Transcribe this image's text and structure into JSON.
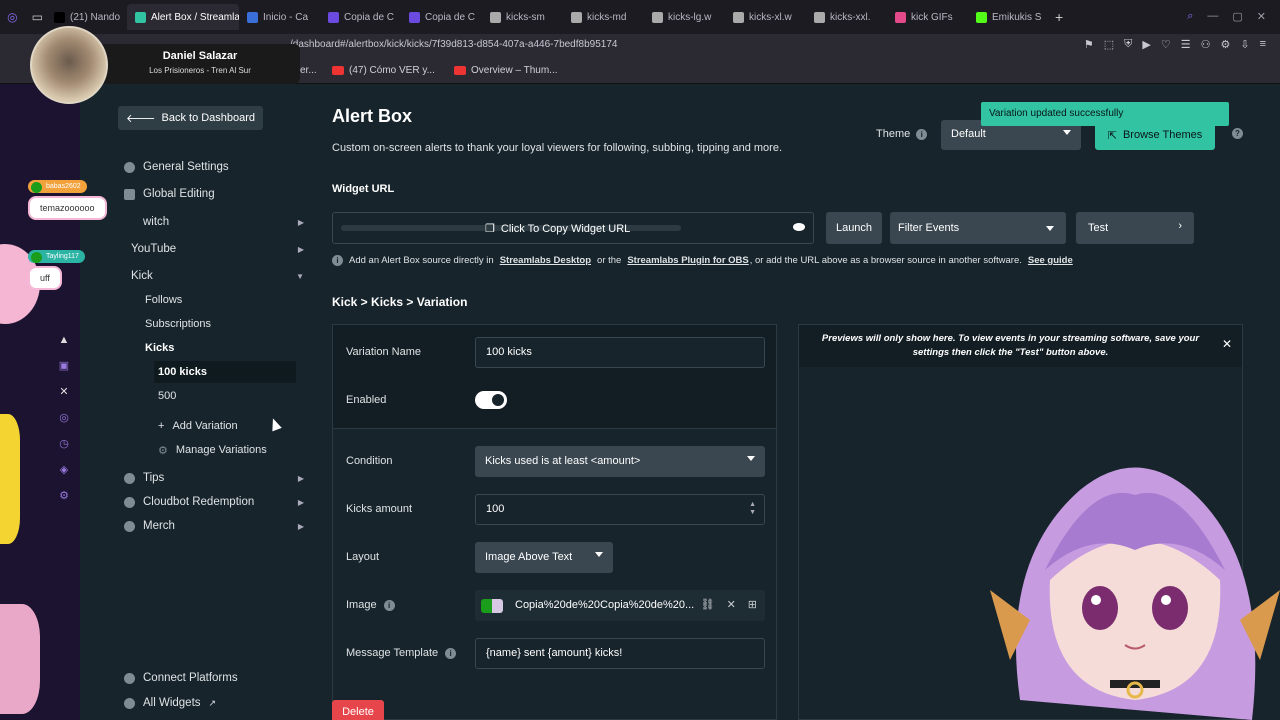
{
  "browser": {
    "tabs": [
      {
        "label": "(21) Nando",
        "color": "#000000"
      },
      {
        "label": "Alert Box / Streamlabs",
        "color": "#31c3a2",
        "active": true
      },
      {
        "label": "Inicio - Ca",
        "color": "#3b6fd8"
      },
      {
        "label": "Copia de C",
        "color": "#6b4ae0"
      },
      {
        "label": "Copia de C",
        "color": "#6b4ae0"
      },
      {
        "label": "kicks-sm",
        "color": "#aaaaaa"
      },
      {
        "label": "kicks-md",
        "color": "#aaaaaa"
      },
      {
        "label": "kicks-lg.w",
        "color": "#aaaaaa"
      },
      {
        "label": "kicks-xl.w",
        "color": "#aaaaaa"
      },
      {
        "label": "kicks-xxl.",
        "color": "#aaaaaa"
      },
      {
        "label": "kick GIFs",
        "color": "#e34a8a"
      },
      {
        "label": "Emikukis S",
        "color": "#53fc18"
      }
    ],
    "url": "/dashboard#/alertbox/kick/kicks/7f39d813-d854-407a-a446-7bedf8b95174",
    "bookmarks": [
      {
        "label": "er..."
      },
      {
        "label": "(47) Cómo VER y..."
      },
      {
        "label": "Overview – Thum..."
      }
    ]
  },
  "overlay": {
    "profile_name": "Daniel Salazar",
    "song": "Los Prisioneros - Tren Al Sur",
    "chat": [
      {
        "user": "babas2602",
        "message": "temazoooooo"
      },
      {
        "user": "Tayling117",
        "message": "uff"
      }
    ]
  },
  "sidebar": {
    "back_label": "Back to Dashboard",
    "general_settings": "General Settings",
    "global_editing": "Global Editing",
    "twitch": "witch",
    "youtube": "YouTube",
    "kick": "Kick",
    "follows": "Follows",
    "subscriptions": "Subscriptions",
    "kicks": "Kicks",
    "variation_100": "100 kicks",
    "variation_500": "500",
    "add_variation": "Add Variation",
    "manage_variations": "Manage Variations",
    "tips": "Tips",
    "cloudbot": "Cloudbot Redemption",
    "merch": "Merch",
    "connect_platforms": "Connect Platforms",
    "all_widgets": "All Widgets"
  },
  "header": {
    "title": "Alert Box",
    "subtitle": "Custom on-screen alerts to thank your loyal viewers for following, subbing, tipping and more.",
    "theme_label": "Theme",
    "theme_value": "Default",
    "browse_themes": "Browse Themes",
    "toast": "Variation updated successfully"
  },
  "widget": {
    "label": "Widget URL",
    "copy_label": "Click To Copy Widget URL",
    "launch": "Launch",
    "filter_events": "Filter Events",
    "test": "Test",
    "help_prefix": "Add an Alert Box source directly in",
    "help_link1": "Streamlabs Desktop",
    "help_mid": "or the",
    "help_link2": "Streamlabs Plugin for OBS",
    "help_suffix": ", or add the URL above as a browser source in another software.",
    "help_link3": "See guide"
  },
  "breadcrumb": "Kick > Kicks > Variation",
  "form": {
    "variation_name_label": "Variation Name",
    "variation_name_value": "100 kicks",
    "enabled_label": "Enabled",
    "enabled": true,
    "condition_label": "Condition",
    "condition_value": "Kicks used is at least <amount>",
    "kicks_amount_label": "Kicks amount",
    "kicks_amount_value": "100",
    "layout_label": "Layout",
    "layout_value": "Image Above Text",
    "image_label": "Image",
    "image_value": "Copia%20de%20Copia%20de%20...",
    "message_label": "Message Template",
    "message_value": "{name} sent {amount} kicks!",
    "delete": "Delete"
  },
  "preview": {
    "note": "Previews will only show here. To view events in your streaming software, save your settings then click the \"Test\" button above."
  },
  "colors": {
    "accent": "#31c3a2",
    "danger": "#e6454c",
    "background": "#17242b"
  }
}
